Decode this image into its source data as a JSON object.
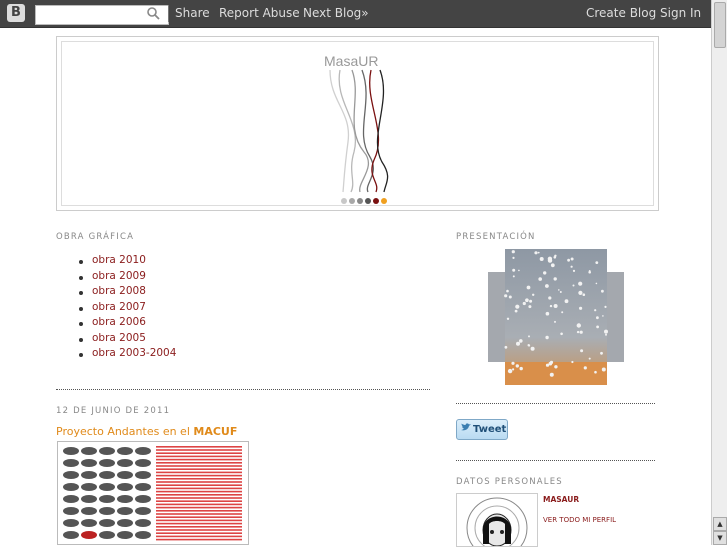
{
  "navbar": {
    "logo_letter": "B",
    "search_value": "",
    "share": "Share",
    "report_abuse": "Report Abuse",
    "next_blog": "Next Blog»",
    "create_blog": "Create Blog",
    "sign_in": "Sign In"
  },
  "header": {
    "logo_text": "MasaUR",
    "dot_colors": [
      "#c8c8c8",
      "#a8a8a8",
      "#888888",
      "#555555",
      "#7a1010",
      "#f0a020"
    ]
  },
  "obra": {
    "title": "OBRA GRÁFICA",
    "items": [
      "obra 2010",
      "obra 2009",
      "obra 2008",
      "obra 2007",
      "obra 2006",
      "obra 2005",
      "obra 2003-2004"
    ]
  },
  "post": {
    "date": "12 DE JUNIO DE 2011",
    "title_prefix": "Proyecto Andantes en el ",
    "title_bold": "MACUF"
  },
  "sidebar": {
    "presentacion_title": "PRESENTACIÓN",
    "tweet_label": "Tweet",
    "datos_title": "DATOS PERSONALES",
    "profile_name": "MASAUR",
    "profile_link": "VER TODO MI PERFIL"
  },
  "colors": {
    "navbar": "#444444",
    "link": "#8a1c1c",
    "post_title": "#e08a1a"
  }
}
